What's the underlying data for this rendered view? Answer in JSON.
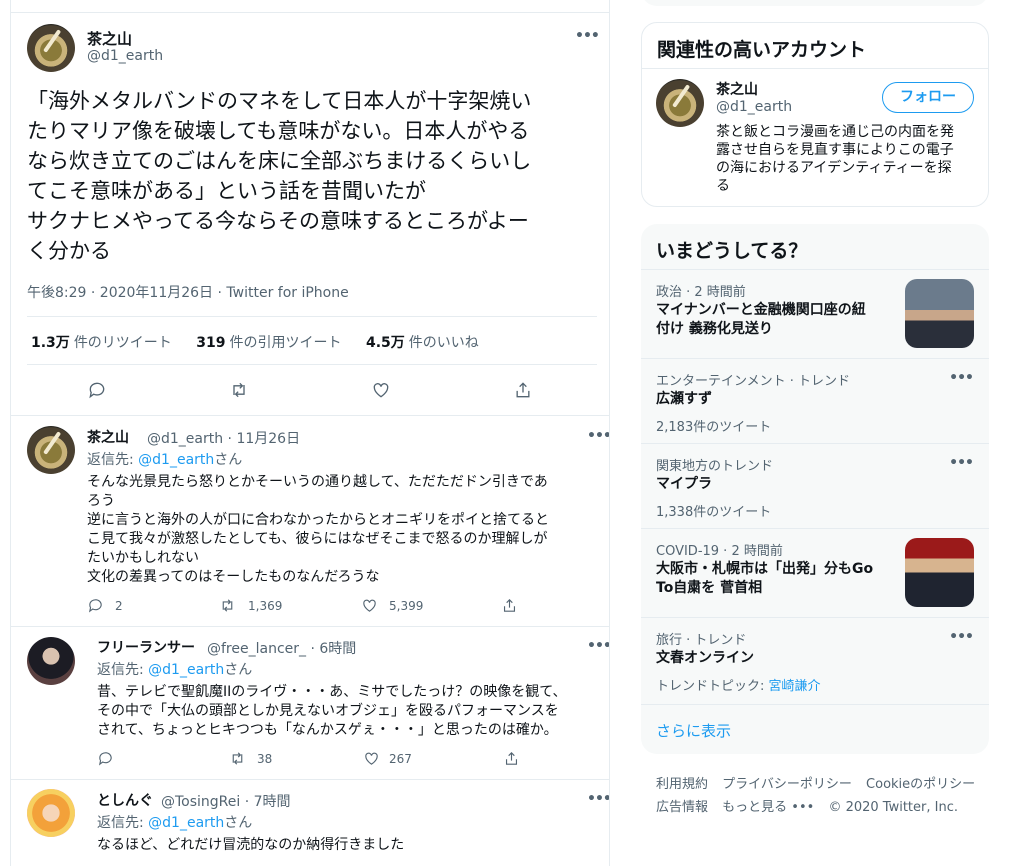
{
  "main_tweet": {
    "name": "茶之山",
    "handle": "@d1_earth",
    "more": "•••",
    "lines": [
      "「海外メタルバンドのマネをして日本人が十字架焼い",
      "たりマリア像を破壊しても意味がない。日本人がやる",
      "なら炊き立てのごはんを床に全部ぶちまけるくらいし",
      "てこそ意味がある」という話を昔聞いたが",
      "サクナヒメやってる今ならその意味するところがよー",
      "く分かる"
    ],
    "meta": "午後8:29 · 2020年11月26日 · Twitter for iPhone",
    "retweets_count": "1.3万",
    "retweets_label": "件のリツイート",
    "quotes_count": "319",
    "quotes_label": "件の引用ツイート",
    "likes_count": "4.5万",
    "likes_label": "件のいいね"
  },
  "replies": [
    {
      "name": "茶之山",
      "handle_time": "@d1_earth · 11月26日",
      "reply_prefix": "返信先: ",
      "reply_link": "@d1_earth",
      "reply_suffix": "さん",
      "lines": [
        "そんな光景見たら怒りとかそーいうの通り越して、ただただドン引きであ",
        "ろう",
        "逆に言うと海外の人が口に合わなかったからとオニギリをポイと捨てると",
        "こ見て我々が激怒したとしても、彼らにはなぜそこまで怒るのか理解しが",
        "たいかもしれない",
        "文化の差異ってのはそーしたものなんだろうな"
      ],
      "reply_count": "2",
      "retweet_count": "1,369",
      "like_count": "5,399"
    },
    {
      "name": "フリーランサー",
      "handle_time": "@free_lancer_ · 6時間",
      "reply_prefix": "返信先: ",
      "reply_link": "@d1_earth",
      "reply_suffix": "さん",
      "lines": [
        "昔、テレビで聖飢魔IIのライヴ・・・あ、ミサでしたっけ？の映像を観て、",
        "その中で「大仏の頭部としか見えないオブジェ」を殴るパフォーマンスを",
        "されて、ちょっとヒキつつも「なんかスゲぇ・・・」と思ったのは確か。"
      ],
      "reply_count": "",
      "retweet_count": "38",
      "like_count": "267"
    },
    {
      "name": "としんぐ",
      "handle_time": "@TosingRei · 7時間",
      "reply_prefix": "返信先: ",
      "reply_link": "@d1_earth",
      "reply_suffix": "さん",
      "lines": [
        "なるほど、どれだけ冒涜的なのか納得行きました"
      ]
    }
  ],
  "related": {
    "title": "関連性の高いアカウント",
    "name": "茶之山",
    "handle": "@d1_earth",
    "follow_label": "フォロー",
    "bio_lines": [
      "茶と飯とコラ漫画を通じ己の内面を発",
      "露させ自らを見直す事によりこの電子",
      "の海におけるアイデンティティーを探",
      "る"
    ]
  },
  "trends": {
    "title": "いまどうしてる？",
    "items": [
      {
        "category": "政治 · 2 時間前",
        "name_lines": [
          "マイナンバーと金融機関口座の紐",
          "付け 義務化見送り"
        ],
        "count": ""
      },
      {
        "category": "エンターテインメント · トレンド",
        "name_lines": [
          "広瀬すず"
        ],
        "count": "2,183件のツイート"
      },
      {
        "category": "関東地方のトレンド",
        "name_lines": [
          "マイプラ"
        ],
        "count": "1,338件のツイート"
      },
      {
        "category": "COVID-19 · 2 時間前",
        "name_lines": [
          "大阪市・札幌市は「出発」分もGo",
          "To自粛を 菅首相"
        ],
        "count": ""
      },
      {
        "category": "旅行 · トレンド",
        "name_lines": [
          "文春オンライン"
        ],
        "count_prefix": "トレンドトピック: ",
        "count_link": "宮崎謙介"
      }
    ],
    "more_label": "•••",
    "show_more": "さらに表示"
  },
  "footer": {
    "line1": [
      "利用規約",
      "プライバシーポリシー",
      "Cookieのポリシー"
    ],
    "line2": [
      "広告情報",
      "もっと見る •••",
      "© 2020 Twitter, Inc."
    ]
  }
}
